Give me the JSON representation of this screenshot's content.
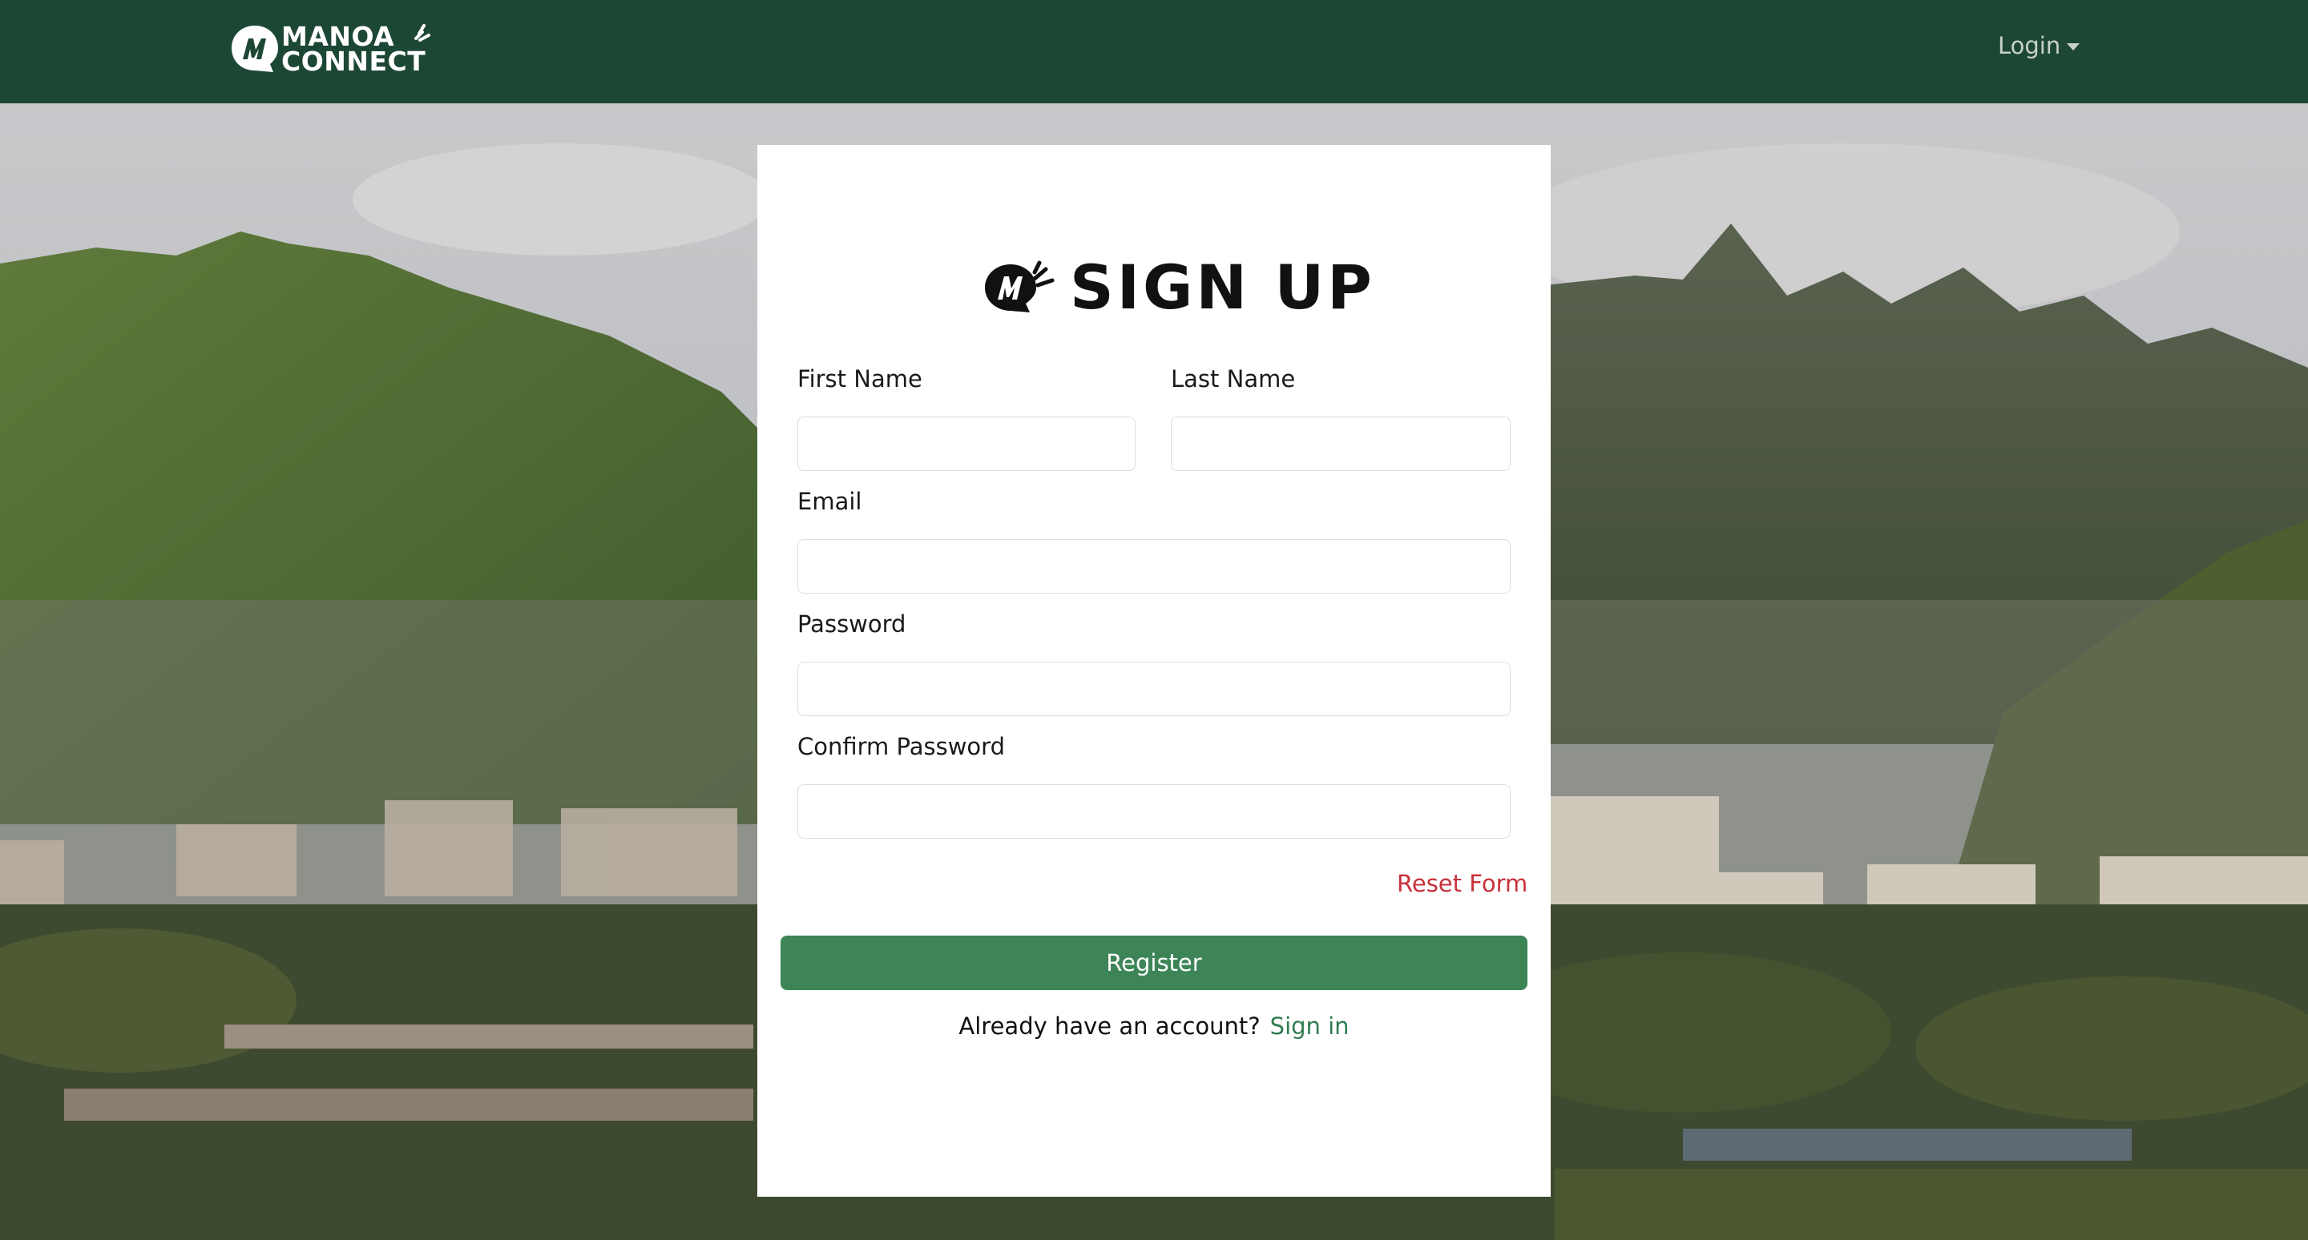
{
  "navbar": {
    "logo_line1": "MANOA",
    "logo_line2": "CONNECT",
    "login_label": "Login"
  },
  "form": {
    "heading": "SIGN UP",
    "first_name_label": "First Name",
    "last_name_label": "Last Name",
    "email_label": "Email",
    "password_label": "Password",
    "confirm_password_label": "Confirm Password",
    "first_name_value": "",
    "last_name_value": "",
    "email_value": "",
    "password_value": "",
    "confirm_password_value": "",
    "reset_label": "Reset Form",
    "register_label": "Register",
    "account_prompt": "Already have an account?",
    "signin_label": "Sign in"
  },
  "colors": {
    "navbar_bg": "#1d4735",
    "register_bg": "#3d8557",
    "reset_text": "#c8303b",
    "signin_link": "#2e7d4f"
  }
}
